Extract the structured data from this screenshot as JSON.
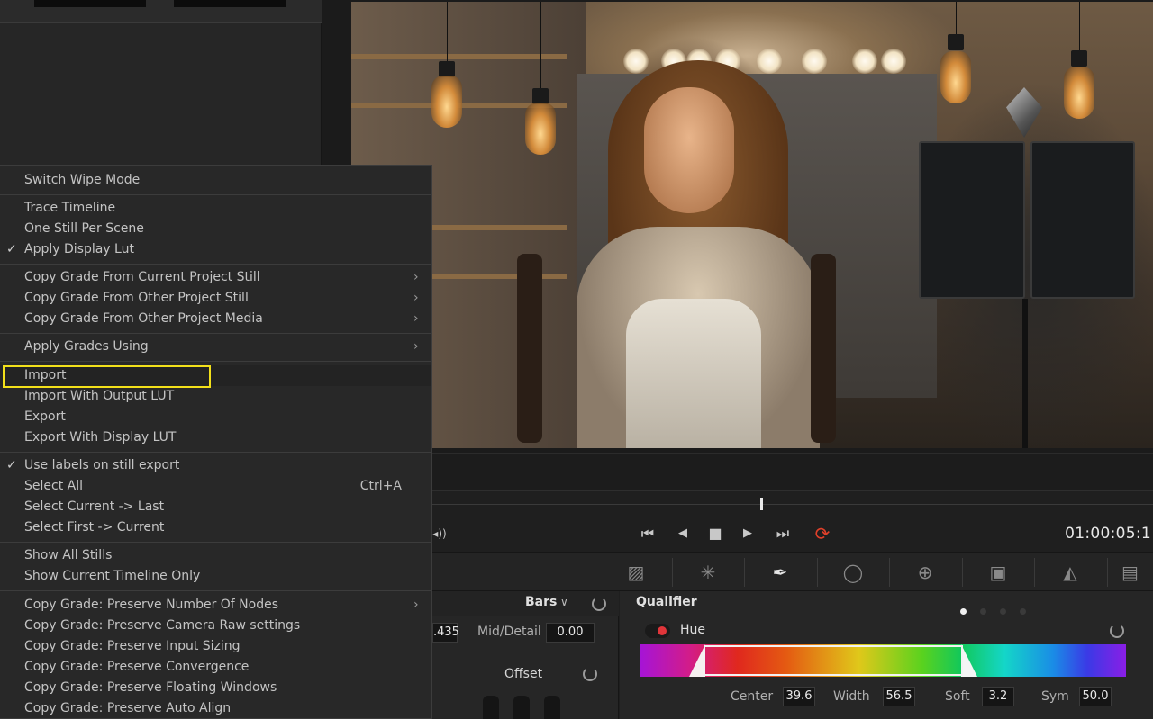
{
  "menu": {
    "items": [
      {
        "label": "Switch Wipe Mode"
      },
      {
        "label": "Trace Timeline"
      },
      {
        "label": "One Still Per Scene"
      },
      {
        "label": "Apply Display Lut",
        "check": "✓"
      },
      {
        "label": "Copy Grade From Current Project Still",
        "arrow": "›"
      },
      {
        "label": "Copy Grade From Other Project Still",
        "arrow": "›"
      },
      {
        "label": "Copy Grade From Other Project Media",
        "arrow": "›"
      },
      {
        "label": "Apply Grades Using",
        "arrow": "›"
      },
      {
        "label": "Import"
      },
      {
        "label": "Import With Output LUT"
      },
      {
        "label": "Export"
      },
      {
        "label": "Export With Display LUT"
      },
      {
        "label": "Use labels on still export",
        "check": "✓"
      },
      {
        "label": "Select All",
        "shortcut": "Ctrl+A"
      },
      {
        "label": "Select Current -> Last"
      },
      {
        "label": "Select First -> Current"
      },
      {
        "label": "Show All Stills"
      },
      {
        "label": "Show Current Timeline Only"
      },
      {
        "label": "Copy Grade: Preserve Number Of Nodes",
        "arrow": "›"
      },
      {
        "label": "Copy Grade: Preserve Camera Raw settings"
      },
      {
        "label": "Copy Grade: Preserve Input Sizing"
      },
      {
        "label": "Copy Grade: Preserve Convergence"
      },
      {
        "label": "Copy Grade: Preserve Floating Windows"
      },
      {
        "label": "Copy Grade: Preserve Auto Align"
      }
    ]
  },
  "viewer": {
    "timecode": "01:00:05:1"
  },
  "transport": {
    "audio_icon": "◂))",
    "first_frame": "⏮",
    "play_reverse": "◀",
    "stop": "■",
    "play": "▶",
    "last_frame": "⏭",
    "loop": "⟳"
  },
  "tools": [
    {
      "icon": "curves-icon",
      "glyph": "▨"
    },
    {
      "icon": "color-warper-icon",
      "glyph": "✳"
    },
    {
      "icon": "qualifier-eyedropper-icon",
      "glyph": "✒"
    },
    {
      "icon": "window-icon",
      "glyph": "◯"
    },
    {
      "icon": "tracker-icon",
      "glyph": "⊕"
    },
    {
      "icon": "magic-mask-icon",
      "glyph": "▣"
    },
    {
      "icon": "blur-icon",
      "glyph": "◭"
    },
    {
      "icon": "key-icon",
      "glyph": "▤"
    }
  ],
  "primaries": {
    "mode_label": "Bars",
    "mode_chevron": "∨",
    "value_partial": ".435",
    "mid_detail_label": "Mid/Detail",
    "mid_detail_value": "0.00",
    "offset_label": "Offset"
  },
  "qualifier": {
    "title": "Qualifier",
    "hue_label": "Hue",
    "center_label": "Center",
    "center_value": "39.6",
    "width_label": "Width",
    "width_value": "56.5",
    "soft_label": "Soft",
    "soft_value": "3.2",
    "sym_label": "Sym",
    "sym_value": "50.0"
  },
  "colors": {
    "highlight_box": "#f2e01a",
    "hue_toggle_on": "#e0353a"
  }
}
